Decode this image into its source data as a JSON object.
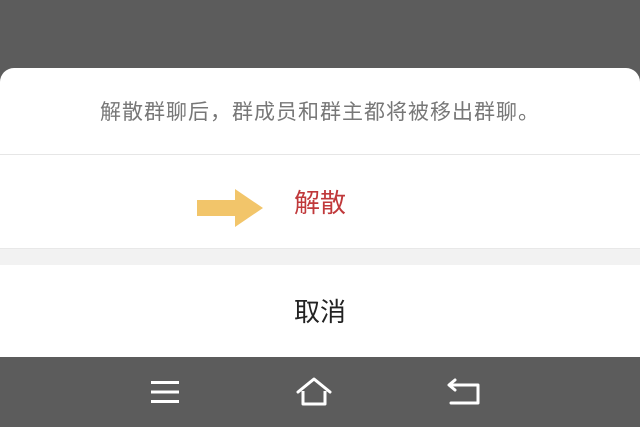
{
  "dialog": {
    "message": "解散群聊后，群成员和群主都将被移出群聊。",
    "confirm_label": "解散",
    "cancel_label": "取消"
  },
  "colors": {
    "destructive": "#c0393b",
    "arrow": "#f2c56a",
    "overlay": "#5c5c5c"
  },
  "nav_bar": {
    "icons": [
      "menu-icon",
      "home-icon",
      "back-icon"
    ]
  }
}
